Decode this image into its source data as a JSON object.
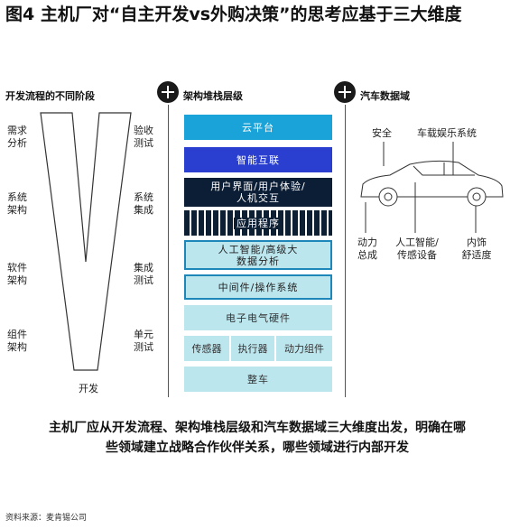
{
  "title": "图4 主机厂对“自主开发vs外购决策”的思考应基于三大维度",
  "columns": {
    "dev": "开发流程的不同阶段",
    "arch": "架构堆栈层级",
    "car": "汽车数据域"
  },
  "v_labels": {
    "left": [
      "需求\n分析",
      "系统\n架构",
      "软件\n架构",
      "组件\n架构"
    ],
    "right": [
      "验收\n测试",
      "系统\n集成",
      "集成\n测试",
      "单元\n测试"
    ],
    "bottom": "开发"
  },
  "stack": {
    "layers": [
      "云平台",
      "智能互联",
      "用户界面/用户体验/\n人机交互",
      "应用程序",
      "人工智能/高级大\n数据分析",
      "中间件/操作系统",
      "电子电气硬件"
    ],
    "components": [
      "传感器",
      "执行器",
      "动力组件"
    ],
    "base": "整车"
  },
  "colors": {
    "cloud": "#1aa3d9",
    "connect": "#2a3fcf",
    "ui": "#0b1e36",
    "ai_border": "#1c87b8",
    "hardware": "#bce6ee"
  },
  "car_labels": {
    "top": [
      "安全",
      "车载娱乐系统"
    ],
    "bottom": [
      "动力\n总成",
      "人工智能/\n传感设备",
      "内饰\n舒适度"
    ]
  },
  "summary": "主机厂应从开发流程、架构堆栈层级和汽车数据域三大维度出发，明确在哪些领域建立战略合作伙伴关系，哪些领域进行内部开发",
  "source": "资料来源：麦肯锡公司"
}
